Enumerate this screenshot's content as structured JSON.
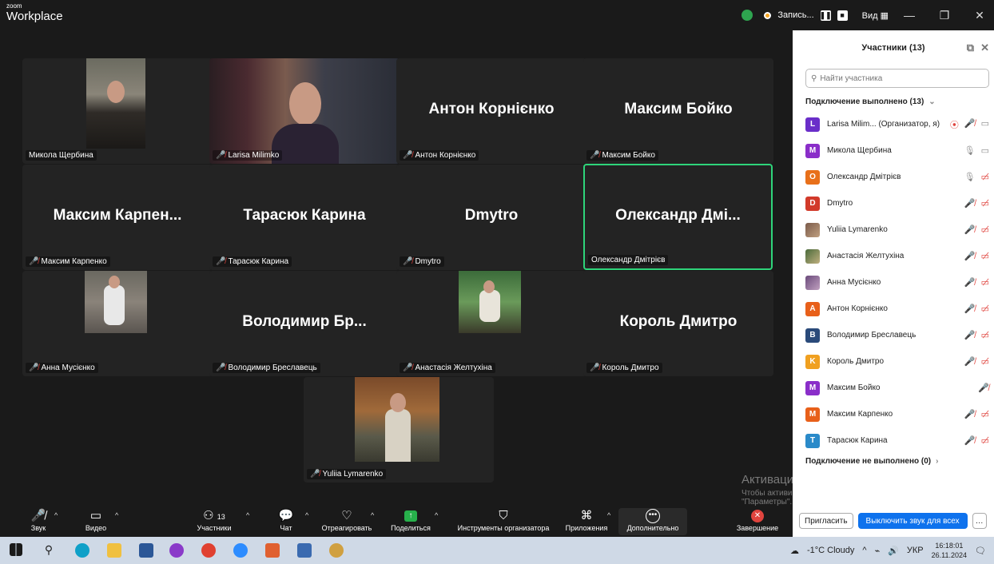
{
  "app": {
    "brand_small": "zoom",
    "brand_large": "Workplace"
  },
  "titlebar": {
    "record_label": "Запись...",
    "view_label": "Вид"
  },
  "tiles": [
    {
      "label": "Микола Щербина",
      "big": "",
      "muted": false
    },
    {
      "label": "Larisa Milimko",
      "big": "",
      "muted": true
    },
    {
      "label": "Антон Корнієнко",
      "big": "Антон Корнієнко",
      "muted": true
    },
    {
      "label": "Максим Бойко",
      "big": "Максим Бойко",
      "muted": true
    },
    {
      "label": "Максим Карпенко",
      "big": "Максим Карпен...",
      "muted": true
    },
    {
      "label": "Тарасюк Карина",
      "big": "Тарасюк Карина",
      "muted": true
    },
    {
      "label": "Dmytro",
      "big": "Dmytro",
      "muted": true
    },
    {
      "label": "Олександр Дмітрієв",
      "big": "Олександр Дмі...",
      "muted": false
    },
    {
      "label": "Анна Мусієнко",
      "big": "",
      "muted": true
    },
    {
      "label": "Володимир Бреславець",
      "big": "Володимир Бр...",
      "muted": true
    },
    {
      "label": "Анастасія Желтухіна",
      "big": "",
      "muted": true
    },
    {
      "label": "Король Дмитро",
      "big": "Король Дмитро",
      "muted": true
    },
    {
      "label": "Yuliia Lymarenko",
      "big": "",
      "muted": true
    }
  ],
  "sidebar": {
    "title": "Участники (13)",
    "search_placeholder": "Найти участника",
    "connected_label": "Подключение выполнено (13)",
    "not_connected_label": "Подключение не выполнено (0)",
    "participants": [
      {
        "initial": "L",
        "color": "#6a2ec9",
        "name": "Larisa Milim... (Организатор, я)"
      },
      {
        "initial": "M",
        "color": "#8a2ec9",
        "name": "Микола Щербина"
      },
      {
        "initial": "O",
        "color": "#e8701a",
        "name": "Олександр Дмітрієв"
      },
      {
        "initial": "D",
        "color": "#d23a2a",
        "name": "Dmytro"
      },
      {
        "initial": "",
        "color": "",
        "name": "Yuliia Lymarenko"
      },
      {
        "initial": "",
        "color": "",
        "name": "Анастасія Желтухіна"
      },
      {
        "initial": "",
        "color": "",
        "name": "Анна Мусієнко"
      },
      {
        "initial": "A",
        "color": "#e8601a",
        "name": "Антон Корнієнко"
      },
      {
        "initial": "B",
        "color": "#2a4a7a",
        "name": "Володимир Бреславець"
      },
      {
        "initial": "K",
        "color": "#f0a020",
        "name": "Король Дмитро"
      },
      {
        "initial": "M",
        "color": "#8a2ec9",
        "name": "Максим Бойко"
      },
      {
        "initial": "M",
        "color": "#e8601a",
        "name": "Максим Карпенко"
      },
      {
        "initial": "T",
        "color": "#2a8ac9",
        "name": "Тарасюк Карина"
      }
    ],
    "invite_label": "Пригласить",
    "mute_all_label": "Выключить звук для всех"
  },
  "toolbar": {
    "audio": "Звук",
    "video": "Видео",
    "participants": "Участники",
    "participants_count": "13",
    "chat": "Чат",
    "react": "Отреагировать",
    "share": "Поделиться",
    "host_tools": "Инструменты организатора",
    "apps": "Приложения",
    "more": "Дополнительно",
    "end": "Завершение"
  },
  "watermark": {
    "line1": "Активация Windows",
    "line2": "Чтобы активировать Windows, перейдите в раздел",
    "line3": "\"Параметры\"."
  },
  "taskbar": {
    "weather": "-1°C Cloudy",
    "lang": "УКР",
    "time": "16:18:01",
    "date": "26.11.2024"
  }
}
